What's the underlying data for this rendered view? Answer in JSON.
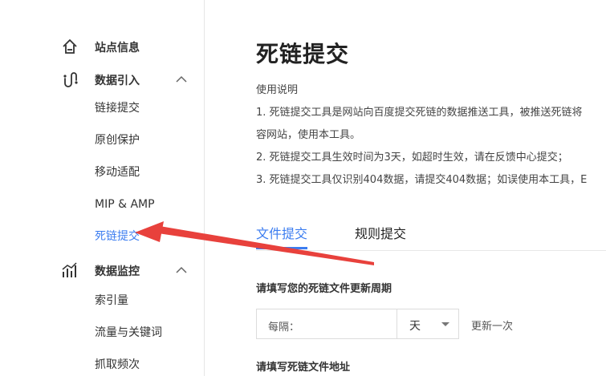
{
  "sidebar": {
    "groups": [
      {
        "label": "站点信息",
        "icon": "home-icon"
      },
      {
        "label": "数据引入",
        "icon": "data-import-icon",
        "expanded": true,
        "items": [
          "链接提交",
          "原创保护",
          "移动适配",
          "MIP & AMP",
          "死链提交"
        ]
      },
      {
        "label": "数据监控",
        "icon": "chart-icon",
        "expanded": true,
        "items": [
          "索引量",
          "流量与关键词",
          "抓取频次"
        ]
      }
    ],
    "active_item": "死链提交"
  },
  "main": {
    "title": "死链提交",
    "help": {
      "title": "使用说明",
      "lines": [
        "1. 死链提交工具是网站向百度提交死链的数据推送工具，被推送死链将",
        "容网站，使用本工具。",
        "2. 死链提交工具生效时间为3天，如超时生效，请在反馈中心提交；",
        "3. 死链提交工具仅识别404数据，请提交404数据；如误使用本工具，E"
      ]
    },
    "tabs": [
      {
        "label": "文件提交",
        "active": true
      },
      {
        "label": "规则提交",
        "active": false
      }
    ],
    "period_section_label": "请填写您的死链文件更新周期",
    "period": {
      "prefix": "每隔：",
      "unit": "天",
      "suffix": "更新一次"
    },
    "address_section_label": "请填写死链文件地址"
  },
  "colors": {
    "accent": "#3c7df0",
    "annotation_arrow": "#e8413c"
  }
}
